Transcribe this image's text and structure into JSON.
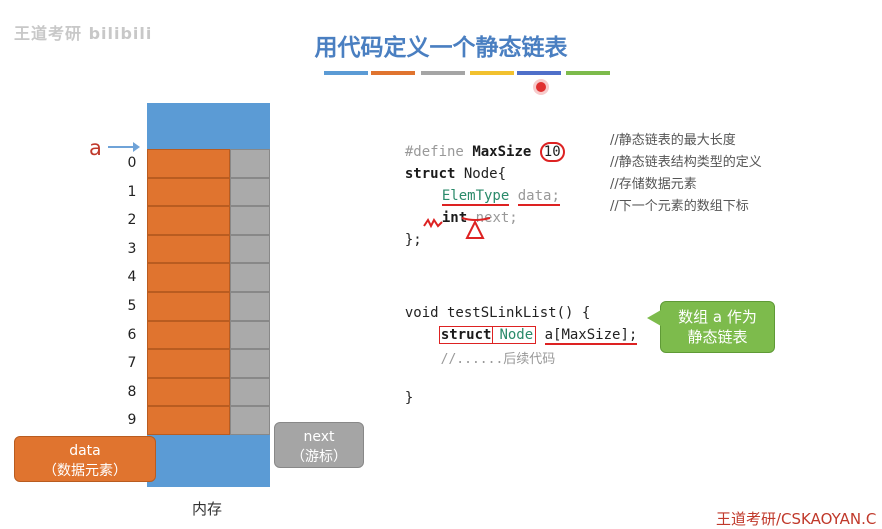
{
  "watermark": "王道考研 bilibili",
  "title": "用代码定义一个静态链表",
  "progress_colors": [
    "#5b9bd5",
    "#e0742f",
    "#a5a5a5",
    "#f2c12e",
    "#4f6fc9",
    "#7dbb4c"
  ],
  "memory": {
    "label": "内存",
    "pointer_label": "a",
    "indices": [
      "0",
      "1",
      "2",
      "3",
      "4",
      "5",
      "6",
      "7",
      "8",
      "9"
    ]
  },
  "data_callout": {
    "line1": "data",
    "line2": "（数据元素）"
  },
  "next_callout": {
    "line1": "next",
    "line2": "（游标）"
  },
  "code": {
    "define": "#define",
    "maxsize": "MaxSize",
    "ten": "10",
    "struct_node": "struct",
    "node": "Node{",
    "elemtype": "ElemType",
    "data": "data;",
    "int": "int",
    "next": "next;",
    "close": "};",
    "func": "void testSLinkList() {",
    "struct2": "struct",
    "node2": "Node",
    "arr": "a[MaxSize];",
    "comment_follow": "//......后续代码",
    "close_func": "}"
  },
  "comments": {
    "c1": "//静态链表的最大长度",
    "c2": "//静态链表结构类型的定义",
    "c3": "//存储数据元素",
    "c4": "//下一个元素的数组下标"
  },
  "green_callout": {
    "line1": "数组 a 作为",
    "line2": "静态链表"
  },
  "footer": "王道考研/CSKAOYAN.C"
}
